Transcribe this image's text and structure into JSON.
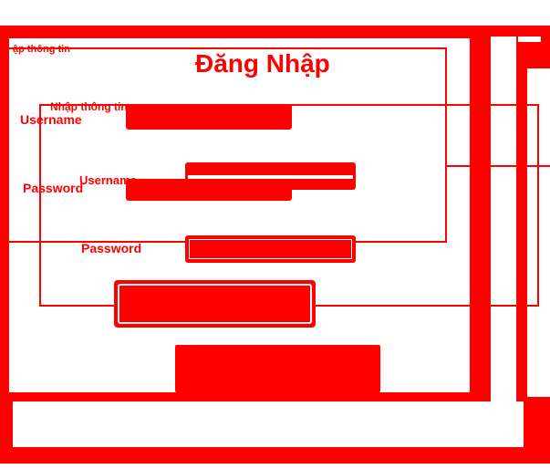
{
  "header": {
    "section_label": "ập thông tin"
  },
  "login": {
    "title": "Đăng Nhập",
    "info_label": "Nhập thông tin",
    "username_label_left": "Username",
    "password_label_left": "Password",
    "username_label": "Username",
    "password_label": "Password"
  },
  "colors": {
    "accent": "#ff0000",
    "background": "#ffffff"
  }
}
